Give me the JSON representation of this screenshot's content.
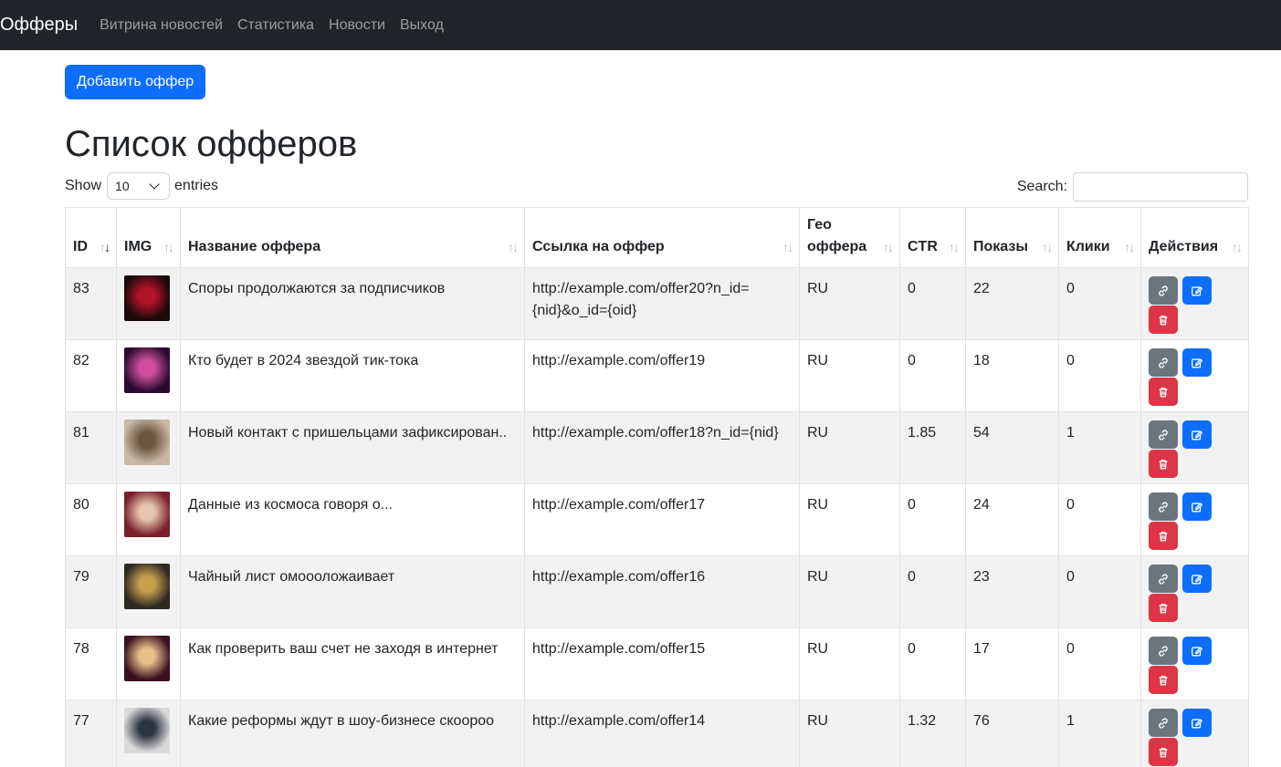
{
  "nav": {
    "brand": "Офферы",
    "links": [
      "Витрина новостей",
      "Статистика",
      "Новости",
      "Выход"
    ]
  },
  "add_button": "Добавить оффер",
  "page_title": "Список офферов",
  "length": {
    "show": "Show",
    "value": "10",
    "entries": "entries"
  },
  "search": {
    "label": "Search:",
    "value": ""
  },
  "columns": [
    "ID",
    "IMG",
    "Название оффера",
    "Ссылка на оффер",
    "Гео оффера",
    "CTR",
    "Показы",
    "Клики",
    "Действия"
  ],
  "rows": [
    {
      "id": "83",
      "name": "Споры продолжаются за подписчиков",
      "link": "http://example.com/offer20?n_id={nid}&o_id={oid}",
      "geo": "RU",
      "ctr": "0",
      "views": "22",
      "clicks": "0"
    },
    {
      "id": "82",
      "name": "Кто будет в 2024 звездой тик-тока",
      "link": "http://example.com/offer19",
      "geo": "RU",
      "ctr": "0",
      "views": "18",
      "clicks": "0"
    },
    {
      "id": "81",
      "name": "Новый контакт с пришельцами зафиксирован..",
      "link": "http://example.com/offer18?n_id={nid}",
      "geo": "RU",
      "ctr": "1.85",
      "views": "54",
      "clicks": "1"
    },
    {
      "id": "80",
      "name": "Данные из космоса говоря о...",
      "link": "http://example.com/offer17",
      "geo": "RU",
      "ctr": "0",
      "views": "24",
      "clicks": "0"
    },
    {
      "id": "79",
      "name": "Чайный лист омоооложаивает",
      "link": "http://example.com/offer16",
      "geo": "RU",
      "ctr": "0",
      "views": "23",
      "clicks": "0"
    },
    {
      "id": "78",
      "name": "Как проверить ваш счет не заходя в интернет",
      "link": "http://example.com/offer15",
      "geo": "RU",
      "ctr": "0",
      "views": "17",
      "clicks": "0"
    },
    {
      "id": "77",
      "name": "Какие реформы ждут в шоу-бизнесе скоороо",
      "link": "http://example.com/offer14",
      "geo": "RU",
      "ctr": "1.32",
      "views": "76",
      "clicks": "1"
    }
  ],
  "thumb_colors": [
    [
      "#1a0a0a",
      "#b3122b"
    ],
    [
      "#2a0a30",
      "#d14fa0"
    ],
    [
      "#c7b8a5",
      "#6b5440"
    ],
    [
      "#7a1f2c",
      "#e6c7b0"
    ],
    [
      "#2d2a22",
      "#c9a050"
    ],
    [
      "#3a1020",
      "#e8c08a"
    ],
    [
      "#d9d9d9",
      "#2b3240"
    ]
  ],
  "colors": {
    "primary": "#0d6efd",
    "secondary": "#6c757d",
    "danger": "#dc3545",
    "navbar": "#212529"
  },
  "icons": {
    "link": "link-icon",
    "edit": "edit-icon",
    "delete": "trash-icon"
  }
}
